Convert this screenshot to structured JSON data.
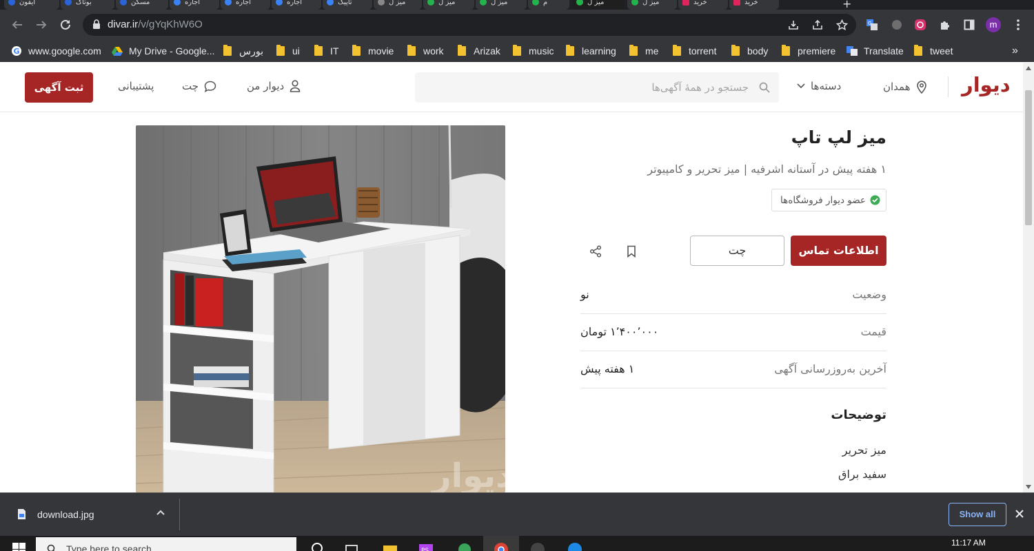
{
  "browser": {
    "tabs": [
      {
        "label": "آیفون"
      },
      {
        "label": "بوتاک"
      },
      {
        "label": "مسکن"
      },
      {
        "label": "اجاره"
      },
      {
        "label": "اجاره"
      },
      {
        "label": "اجاره"
      },
      {
        "label": "تاپیک"
      },
      {
        "label": "میز ل"
      },
      {
        "label": "میز ل"
      },
      {
        "label": "میز ل"
      },
      {
        "label": "م"
      },
      {
        "label": "میز ل"
      },
      {
        "label": "میز ل"
      },
      {
        "label": "خرید"
      },
      {
        "label": "خرید"
      }
    ],
    "url_host": "divar.ir",
    "url_path": "/v/gYqKhW6O",
    "profile_initial": "m",
    "bookmarks": [
      {
        "label": "www.google.com",
        "icon": "google-icon"
      },
      {
        "label": "My Drive - Google...",
        "icon": "drive-icon"
      },
      {
        "label": "بورس",
        "icon": "folder-icon"
      },
      {
        "label": "ui",
        "icon": "folder-icon"
      },
      {
        "label": "IT",
        "icon": "folder-icon"
      },
      {
        "label": "movie",
        "icon": "folder-icon"
      },
      {
        "label": "work",
        "icon": "folder-icon"
      },
      {
        "label": "Arizak",
        "icon": "folder-icon"
      },
      {
        "label": "music",
        "icon": "folder-icon"
      },
      {
        "label": "learning",
        "icon": "folder-icon"
      },
      {
        "label": "me",
        "icon": "folder-icon"
      },
      {
        "label": "torrent",
        "icon": "folder-icon"
      },
      {
        "label": "body",
        "icon": "folder-icon"
      },
      {
        "label": "premiere",
        "icon": "folder-icon"
      },
      {
        "label": "Translate",
        "icon": "translate-icon"
      },
      {
        "label": "tweet",
        "icon": "folder-icon"
      }
    ],
    "bookmarks_overflow": "»"
  },
  "site": {
    "logo": "دیوار",
    "city": "همدان",
    "categories": "دسته‌ها",
    "search_placeholder": "جستجو در همهٔ آگهی‌ها",
    "my_divar": "دیوار من",
    "chat": "چت",
    "support": "پشتیبانی",
    "post_ad": "ثبت آگهی",
    "brand_color": "#a62626"
  },
  "listing": {
    "title": "میز لپ تاپ",
    "subtitle": "۱ هفته پیش در آستانه اشرفیه | میز تحریر و کامپیوتر",
    "badge": "عضو دیوار فروشگاه‌ها",
    "contact_button": "اطلاعات تماس",
    "chat_button": "چت",
    "details": [
      {
        "key": "وضعیت",
        "value": "نو"
      },
      {
        "key": "قیمت",
        "value": "۱٬۴۰۰٬۰۰۰ تومان"
      },
      {
        "key": "آخرین به‌روزرسانی آگهی",
        "value": "۱ هفته پیش"
      }
    ],
    "description_heading": "توضیحات",
    "description_lines": [
      "میز تحریر",
      "سفید براق"
    ],
    "image_watermark": "دیوار"
  },
  "downloads": {
    "filename": "download.jpg",
    "show_all": "Show all"
  },
  "taskbar": {
    "search_placeholder": "Type here to search",
    "time": "11:17 AM"
  }
}
